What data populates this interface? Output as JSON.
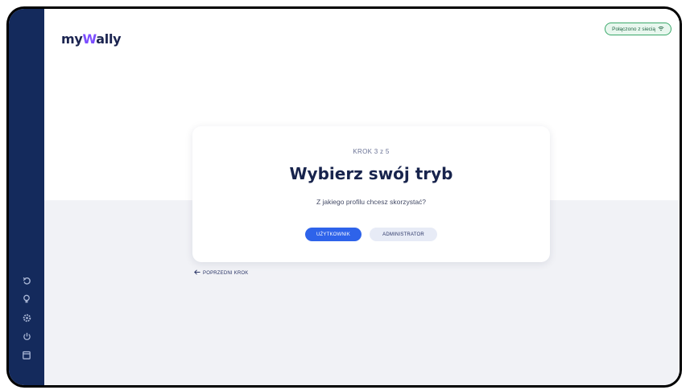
{
  "app": {
    "logo_prefix": "my",
    "logo_accent": "W",
    "logo_suffix": "ally"
  },
  "status": {
    "network_label": "Połączono z siecią",
    "network_icon": "wifi-icon",
    "network_color": "#3aa86a"
  },
  "wizard": {
    "step_label": "KROK 3 z 5",
    "title": "Wybierz swój tryb",
    "subtitle": "Z jakiego profilu chcesz skorzystać?",
    "options": [
      {
        "label": "UŻYTKOWNIK",
        "selected": true
      },
      {
        "label": "ADMINISTRATOR",
        "selected": false
      }
    ],
    "back_label": "POPRZEDNI KROK"
  },
  "sidebar": {
    "icons": [
      "refresh-icon",
      "bulb-icon",
      "settings-icon",
      "power-icon",
      "calendar-icon"
    ]
  },
  "colors": {
    "sidebar_bg": "#142a5c",
    "primary": "#2e63ea",
    "title": "#18244d"
  }
}
